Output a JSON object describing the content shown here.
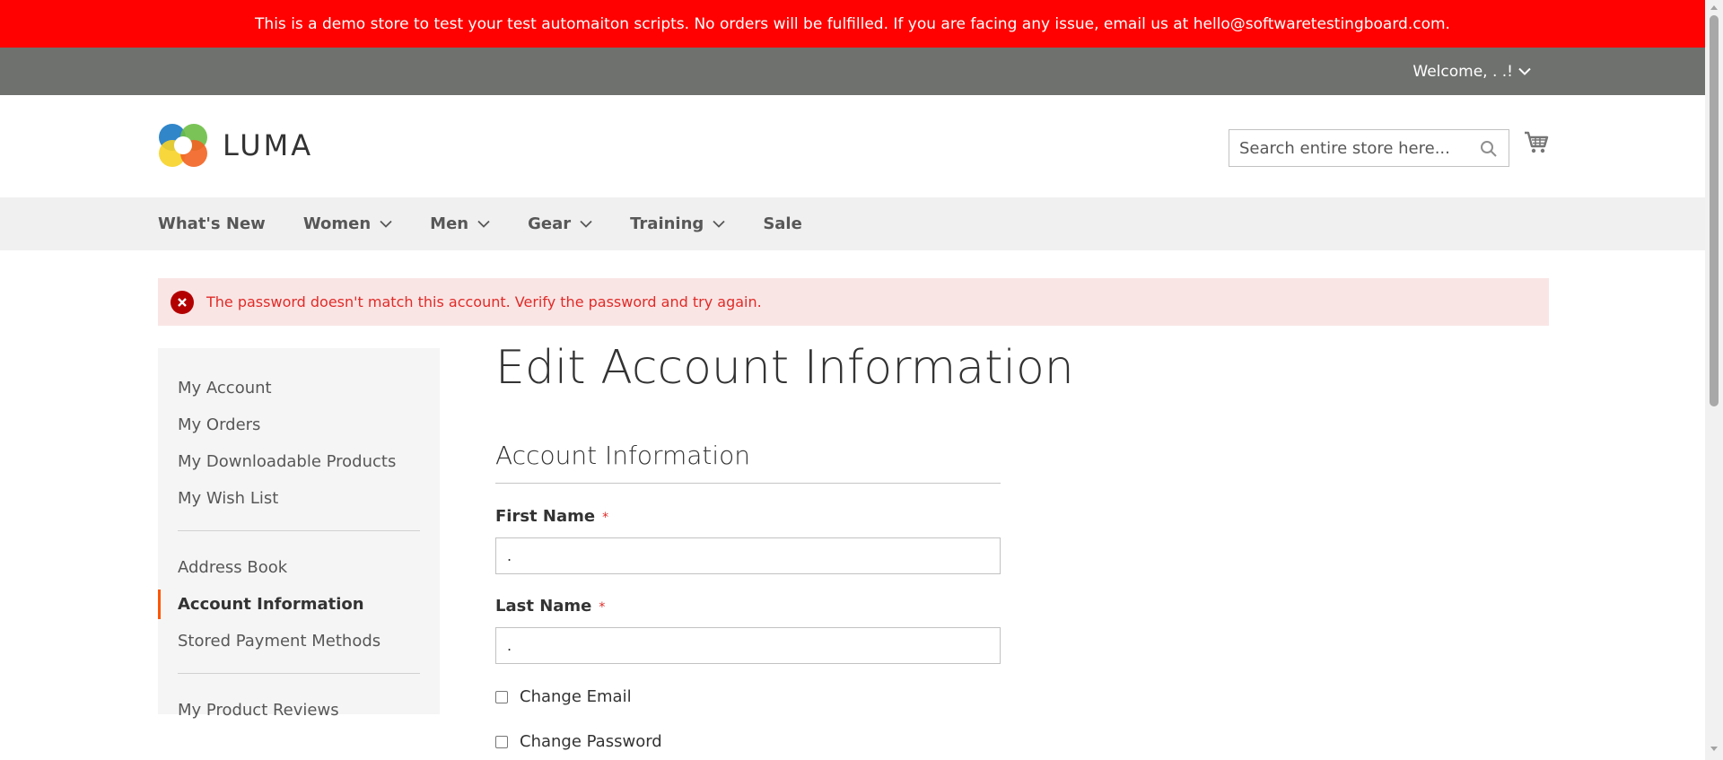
{
  "demo_banner": "This is a demo store to test your test automaiton scripts. No orders will be fulfilled. If you are facing any issue, email us at hello@softwaretestingboard.com.",
  "header": {
    "welcome": "Welcome, . .!",
    "logo_text": "LUMA",
    "search_placeholder": "Search entire store here..."
  },
  "nav": {
    "items": [
      {
        "label": "What's New",
        "has_submenu": false
      },
      {
        "label": "Women",
        "has_submenu": true
      },
      {
        "label": "Men",
        "has_submenu": true
      },
      {
        "label": "Gear",
        "has_submenu": true
      },
      {
        "label": "Training",
        "has_submenu": true
      },
      {
        "label": "Sale",
        "has_submenu": false
      }
    ]
  },
  "message": {
    "type": "error",
    "text": "The password doesn't match this account. Verify the password and try again."
  },
  "sidebar": {
    "items": [
      {
        "label": "My Account"
      },
      {
        "label": "My Orders"
      },
      {
        "label": "My Downloadable Products"
      },
      {
        "label": "My Wish List"
      },
      {
        "label": "Address Book"
      },
      {
        "label": "Account Information",
        "current": true
      },
      {
        "label": "Stored Payment Methods"
      },
      {
        "label": "My Product Reviews"
      }
    ]
  },
  "main": {
    "page_title": "Edit Account Information",
    "section_title": "Account Information",
    "first_name_label": "First Name",
    "first_name_value": ".",
    "last_name_label": "Last Name",
    "last_name_value": ".",
    "required_marker": "*",
    "change_email_label": "Change Email",
    "change_password_label": "Change Password"
  },
  "colors": {
    "demo_banner_bg": "#ff0101",
    "panel_header_bg": "#6e716e",
    "nav_bg": "#f0f0f0",
    "error_bg": "#fae5e5",
    "error_text": "#e02b27",
    "current_accent": "#ff5501"
  }
}
